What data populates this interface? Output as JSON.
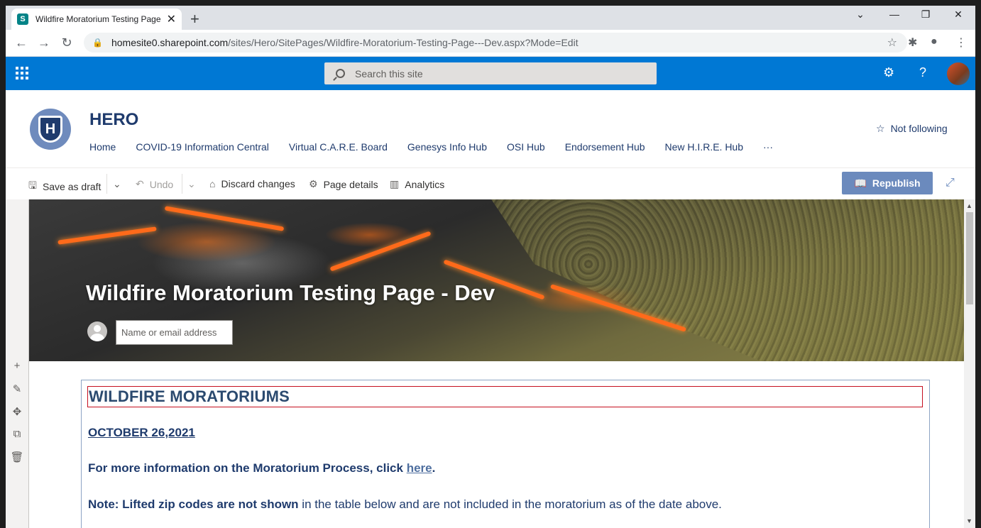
{
  "browser": {
    "tab_title": "Wildfire Moratorium Testing Page",
    "tab_favicon_letter": "S",
    "url_host": "homesite0.sharepoint.com",
    "url_path": "/sites/Hero/SitePages/Wildfire-Moratorium-Testing-Page---Dev.aspx?Mode=Edit",
    "icons": [
      "back-icon",
      "forward-icon",
      "reload-icon",
      "lock-icon",
      "star-icon",
      "puzzle-icon",
      "profile-icon",
      "menu-icon"
    ]
  },
  "suitebar": {
    "search_placeholder": "Search this site",
    "accent": "#0078d4"
  },
  "site": {
    "logo_letter": "H",
    "title": "HERO",
    "nav": [
      "Home",
      "COVID-19 Information Central",
      "Virtual C.A.R.E. Board",
      "Genesys Info Hub",
      "OSI Hub",
      "Endorsement Hub",
      "New H.I.R.E. Hub",
      "···"
    ],
    "follow_label": "Not following"
  },
  "commandbar": {
    "save_draft": "Save as draft",
    "undo": "Undo",
    "discard": "Discard changes",
    "page_details": "Page details",
    "analytics": "Analytics",
    "republish": "Republish",
    "republish_color": "#6b8abd"
  },
  "page": {
    "hero_title": "Wildfire Moratorium Testing Page - Dev",
    "author_placeholder": "Name or email address",
    "heading": "WILDFIRE MORATORIUMS",
    "date": "OCTOBER 26,2021",
    "info_prefix": "For more information on the Moratorium Process, click ",
    "info_link": "here",
    "info_suffix": ".",
    "note_bold": "Note: Lifted zip codes are not shown",
    "note_rest": " in the table below and are not included in the moratorium as of the date above."
  }
}
